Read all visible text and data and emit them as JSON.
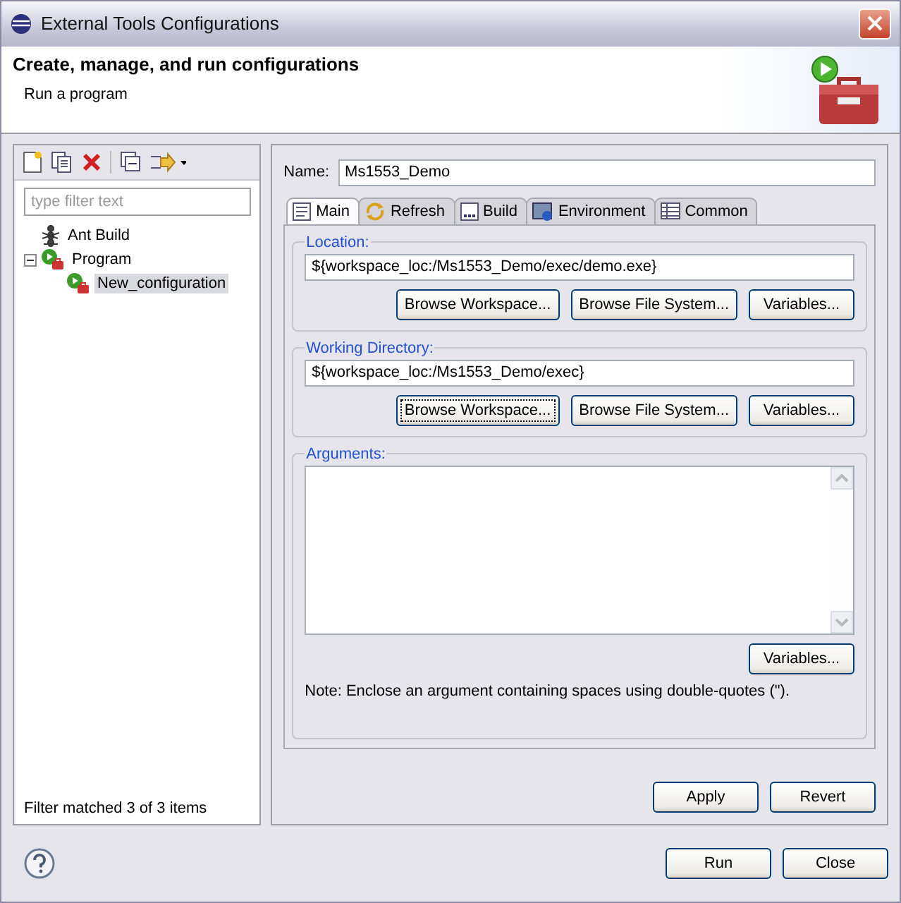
{
  "window": {
    "title": "External Tools Configurations"
  },
  "header": {
    "title": "Create, manage, and run configurations",
    "subtitle": "Run a program"
  },
  "sidebar": {
    "filter": {
      "placeholder": "type filter text"
    },
    "tree": [
      {
        "label": "Ant Build",
        "kind": "ant",
        "selected": false
      },
      {
        "label": "Program",
        "kind": "program",
        "selected": false,
        "expanded": true,
        "children": [
          {
            "label": "New_configuration",
            "kind": "program",
            "selected": true
          }
        ]
      }
    ],
    "status": "Filter matched 3 of 3 items"
  },
  "name": {
    "label": "Name:",
    "value": "Ms1553_Demo"
  },
  "tabs": [
    {
      "label": "Main",
      "kind": "main",
      "selected": true
    },
    {
      "label": "Refresh",
      "kind": "refresh",
      "selected": false
    },
    {
      "label": "Build",
      "kind": "build",
      "selected": false
    },
    {
      "label": "Environment",
      "kind": "environment",
      "selected": false
    },
    {
      "label": "Common",
      "kind": "common",
      "selected": false
    }
  ],
  "groups": [
    {
      "title": "Location:",
      "value": "${workspace_loc:/Ms1553_Demo/exec/demo.exe}",
      "buttons": [
        {
          "label": "Browse Workspace...",
          "focused": false
        },
        {
          "label": "Browse File System...",
          "focused": false
        },
        {
          "label": "Variables...",
          "focused": false
        }
      ]
    },
    {
      "title": "Working Directory:",
      "value": "${workspace_loc:/Ms1553_Demo/exec}",
      "buttons": [
        {
          "label": "Browse Workspace...",
          "focused": true
        },
        {
          "label": "Browse File System...",
          "focused": false
        },
        {
          "label": "Variables...",
          "focused": false
        }
      ]
    }
  ],
  "arguments": {
    "title": "Arguments:",
    "buttons": [
      {
        "label": "Variables...",
        "focused": false
      }
    ],
    "note": "Note: Enclose an argument containing spaces using double-quotes (\")."
  },
  "actions": [
    "Apply",
    "Revert"
  ],
  "footer_buttons": [
    "Run",
    "Close"
  ]
}
